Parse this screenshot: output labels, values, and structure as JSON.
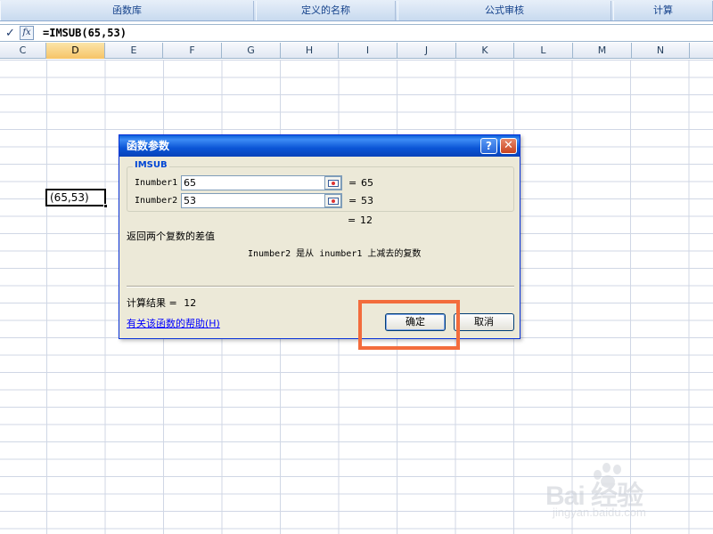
{
  "ribbon": {
    "groups": [
      "函数库",
      "定义的名称",
      "公式审核",
      "计算"
    ]
  },
  "formula_bar": {
    "confirm_icon": "check-icon",
    "fx_label": "fx",
    "formula": "=IMSUB(65,53)"
  },
  "columns": [
    "C",
    "D",
    "E",
    "F",
    "G",
    "H",
    "I",
    "J",
    "K",
    "L",
    "M",
    "N"
  ],
  "selected_column": "D",
  "active_cell": {
    "text": "(65,53)"
  },
  "dialog": {
    "title": "函数参数",
    "help_button": "?",
    "close_button": "✕",
    "function_name": "IMSUB",
    "args": [
      {
        "label": "Inumber1",
        "value": "65",
        "eq": "=",
        "result": "65"
      },
      {
        "label": "Inumber2",
        "value": "53",
        "eq": "=",
        "result": "53"
      }
    ],
    "result_eq": "=",
    "result_value": "12",
    "description": "返回两个复数的差值",
    "arg_description": "Inumber2  是从 inumber1 上减去的复数",
    "calc_result_label": "计算结果 =",
    "calc_result_value": "12",
    "help_link": "有关该函数的帮助(H)",
    "ok_label": "确定",
    "cancel_label": "取消"
  },
  "colors": {
    "highlight": "#f36c3c",
    "titlebar": "#0b55d6",
    "dialog_bg": "#ece9d8"
  },
  "watermark": {
    "text": "Bai 经验",
    "url": "jingyan.baidu.com"
  }
}
